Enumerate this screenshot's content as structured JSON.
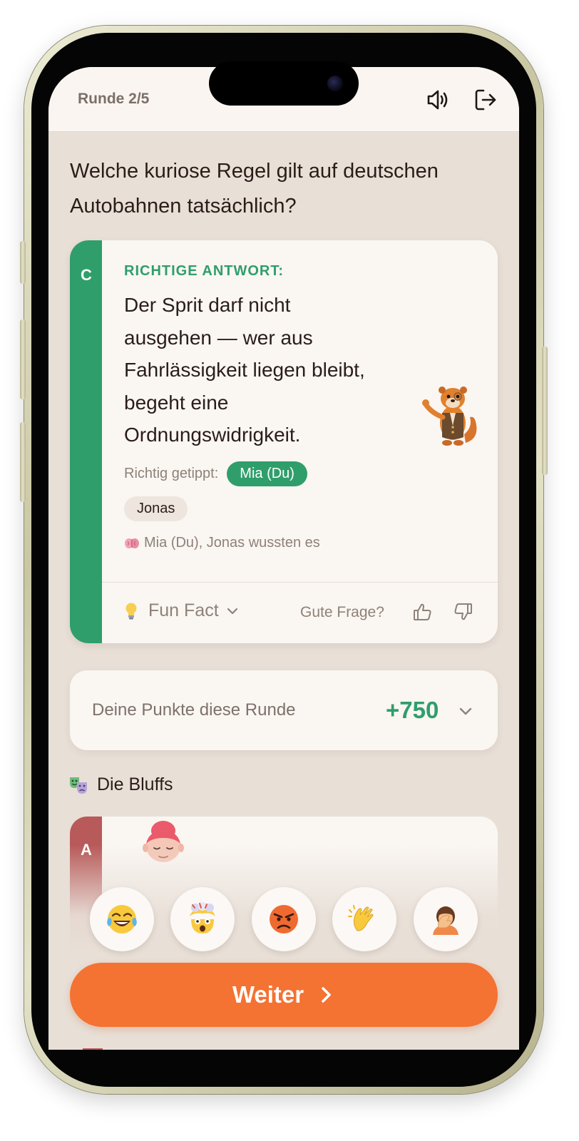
{
  "header": {
    "round_label": "Runde 2/5"
  },
  "question": {
    "text": "Welche kuriose Regel gilt auf deutschen Autobahnen tatsächlich?"
  },
  "answer_card": {
    "letter": "C",
    "title": "RICHTIGE ANTWORT:",
    "text": "Der Sprit darf nicht ausgehen — wer aus Fahrlässigkeit liegen bleibt, begeht eine Ordnungswidrigkeit.",
    "tipped_label": "Richtig getippt:",
    "tipped_players": [
      "Mia (Du)",
      "Jonas"
    ],
    "knew_text": "Mia (Du), Jonas wussten es",
    "funfact_label": "Fun Fact",
    "feedback_label": "Gute Frage?",
    "accent_color": "#2f9e6b"
  },
  "points": {
    "label": "Deine Punkte diese Runde",
    "value": "+750"
  },
  "bluffs": {
    "title": "Die Bluffs",
    "first_letter": "A"
  },
  "reactions": [
    "face-with-tears-of-joy",
    "exploding-head",
    "angry-face",
    "clapping-hands",
    "person-facepalming"
  ],
  "continue_button": {
    "label": "Weiter",
    "color": "#f47232"
  }
}
